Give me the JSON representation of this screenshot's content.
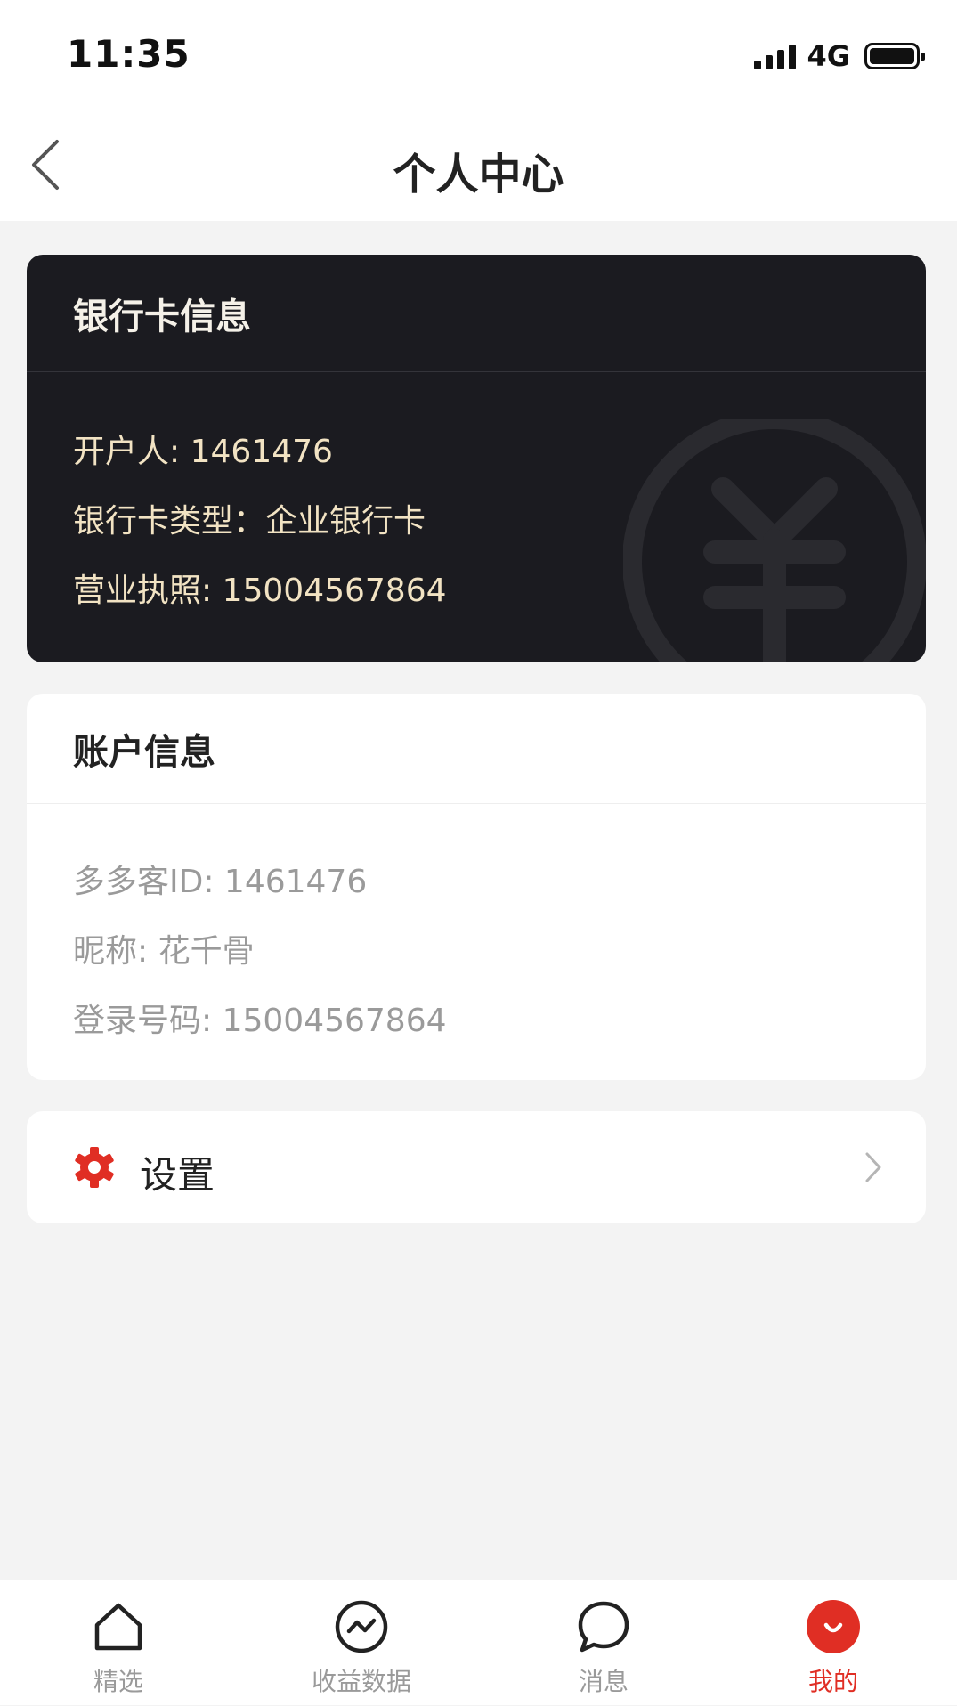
{
  "status_bar": {
    "time": "11:35",
    "network": "4G"
  },
  "header": {
    "title": "个人中心",
    "back_icon": "chevron-left-icon"
  },
  "bank_card": {
    "title": "银行卡信息",
    "account_holder": "开户人: 1461476",
    "card_type": "银行卡类型：企业银行卡",
    "business_license": "营业执照: 15004567864",
    "watermark_icon": "yen-icon"
  },
  "account_info": {
    "title": "账户信息",
    "duoduoke_id": "多多客ID: 1461476",
    "nickname": "昵称: 花千骨",
    "login_number": "登录号码: 15004567864"
  },
  "settings": {
    "label": "设置",
    "icon": "gear-icon",
    "accent": "#e02e24"
  },
  "tabs": [
    {
      "label": "精选",
      "icon": "home-icon",
      "active": false
    },
    {
      "label": "收益数据",
      "icon": "trend-icon",
      "active": false
    },
    {
      "label": "消息",
      "icon": "chat-bubble-icon",
      "active": false
    },
    {
      "label": "我的",
      "icon": "profile-icon",
      "active": true
    }
  ],
  "colors": {
    "accent": "#e02e24",
    "bank_card_bg": "#1b1b20",
    "bank_card_text": "#f2e3c3",
    "page_bg": "#f3f3f3"
  }
}
